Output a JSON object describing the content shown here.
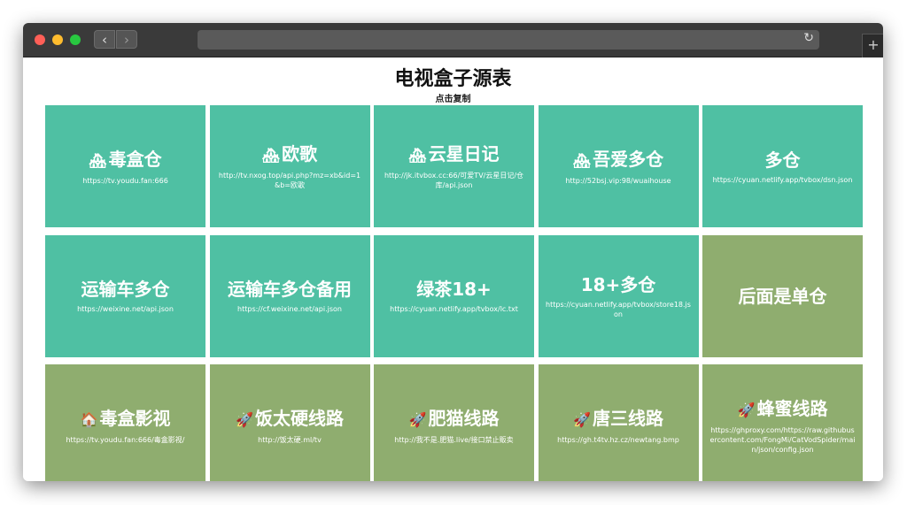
{
  "browser": {
    "back_label": "‹",
    "forward_label": "›",
    "reload_icon": "↻",
    "new_tab_label": "+"
  },
  "page": {
    "title": "电视盒子源表",
    "subtitle": "点击复制"
  },
  "colors": {
    "teal": "#4fc0a3",
    "olive": "#8fad6f"
  },
  "cards": [
    {
      "icon": "🏘",
      "name": "毒盒仓",
      "url": "https://tv.youdu.fan:666",
      "color": "teal"
    },
    {
      "icon": "🏘",
      "name": "欧歌",
      "url": "http://tv.nxog.top/api.php?mz=xb&id=1&b=欧歌",
      "color": "teal"
    },
    {
      "icon": "🏘",
      "name": "云星日记",
      "url": "http://jk.itvbox.cc:66/可爱TV/云星日记/仓库/api.json",
      "color": "teal"
    },
    {
      "icon": "🏘",
      "name": "吾爱多仓",
      "url": "http://52bsj.vip:98/wuaihouse",
      "color": "teal"
    },
    {
      "icon": "",
      "name": "多仓",
      "url": "https://cyuan.netlify.app/tvbox/dsn.json",
      "color": "teal"
    },
    {
      "icon": "",
      "name": "运输车多仓",
      "url": "https://weixine.net/api.json",
      "color": "teal"
    },
    {
      "icon": "",
      "name": "运输车多仓备用",
      "url": "https://cf.weixine.net/api.json",
      "color": "teal"
    },
    {
      "icon": "",
      "name": "绿茶18+",
      "url": "https://cyuan.netlify.app/tvbox/lc.txt",
      "color": "teal"
    },
    {
      "icon": "",
      "name": "18+多仓",
      "url": "https://cyuan.netlify.app/tvbox/store18.json",
      "color": "teal"
    },
    {
      "icon": "",
      "name": "后面是单仓",
      "url": "",
      "color": "olive"
    },
    {
      "icon": "🏠",
      "name": "毒盒影视",
      "url": "https://tv.youdu.fan:666/毒盒影视/",
      "color": "olive"
    },
    {
      "icon": "🚀",
      "name": "饭太硬线路",
      "url": "http://饭太硬.ml/tv",
      "color": "olive"
    },
    {
      "icon": "🚀",
      "name": "肥猫线路",
      "url": "http://我不是.肥猫.live/接口禁止贩卖",
      "color": "olive"
    },
    {
      "icon": "🚀",
      "name": "唐三线路",
      "url": "https://gh.t4tv.hz.cz/newtang.bmp",
      "color": "olive"
    },
    {
      "icon": "🚀",
      "name": "蜂蜜线路",
      "url": "https://ghproxy.com/https://raw.githubusercontent.com/FongMi/CatVodSpider/main/json/config.json",
      "color": "olive"
    }
  ]
}
